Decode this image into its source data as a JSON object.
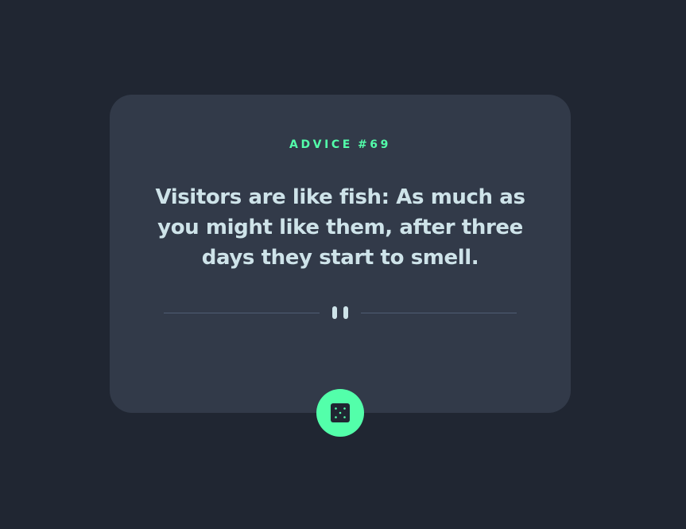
{
  "advice": {
    "label": "ADVICE",
    "number": "#69",
    "text": "Visitors are like fish: As much as you might like them, after three days they start to smell."
  },
  "divider": {
    "icon": "pause-icon"
  },
  "button": {
    "icon": "dice-icon"
  },
  "colors": {
    "background": "#202632",
    "card": "#323a49",
    "accent": "#53ffaa",
    "text": "#cee3e9",
    "divider": "#4f5d74"
  }
}
